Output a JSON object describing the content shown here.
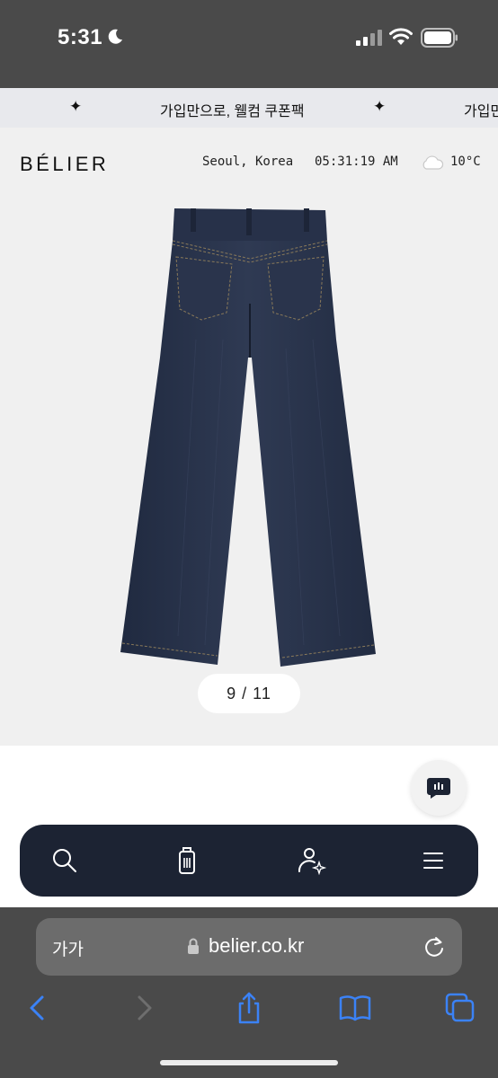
{
  "status_bar": {
    "time": "5:31"
  },
  "promo": {
    "items": [
      "가입만으로, 웰컴 쿠폰팩",
      "가입만으"
    ]
  },
  "header": {
    "logo": "BÉLIER",
    "location": "Seoul, Korea",
    "clock": "05:31:19 AM",
    "temperature": "10°C"
  },
  "product": {
    "pager": "9 / 11"
  },
  "browser": {
    "text_size": "가가",
    "url": "belier.co.kr"
  },
  "icons": {
    "nav": [
      "search-icon",
      "shopping-bag-icon",
      "account-icon",
      "menu-icon"
    ],
    "toolbar": [
      "back-icon",
      "forward-icon",
      "share-icon",
      "bookmarks-icon",
      "tabs-icon"
    ]
  },
  "colors": {
    "nav_background": "#1c2333",
    "safari_accent": "#3b82f6",
    "status_bar": "#4a4a4a"
  }
}
